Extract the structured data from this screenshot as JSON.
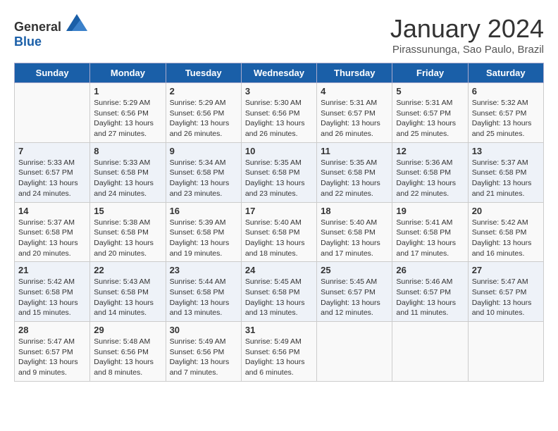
{
  "header": {
    "logo_general": "General",
    "logo_blue": "Blue",
    "month_title": "January 2024",
    "subtitle": "Pirassununga, Sao Paulo, Brazil"
  },
  "days_of_week": [
    "Sunday",
    "Monday",
    "Tuesday",
    "Wednesday",
    "Thursday",
    "Friday",
    "Saturday"
  ],
  "weeks": [
    [
      {
        "day": "",
        "text": ""
      },
      {
        "day": "1",
        "text": "Sunrise: 5:29 AM\nSunset: 6:56 PM\nDaylight: 13 hours\nand 27 minutes."
      },
      {
        "day": "2",
        "text": "Sunrise: 5:29 AM\nSunset: 6:56 PM\nDaylight: 13 hours\nand 26 minutes."
      },
      {
        "day": "3",
        "text": "Sunrise: 5:30 AM\nSunset: 6:56 PM\nDaylight: 13 hours\nand 26 minutes."
      },
      {
        "day": "4",
        "text": "Sunrise: 5:31 AM\nSunset: 6:57 PM\nDaylight: 13 hours\nand 26 minutes."
      },
      {
        "day": "5",
        "text": "Sunrise: 5:31 AM\nSunset: 6:57 PM\nDaylight: 13 hours\nand 25 minutes."
      },
      {
        "day": "6",
        "text": "Sunrise: 5:32 AM\nSunset: 6:57 PM\nDaylight: 13 hours\nand 25 minutes."
      }
    ],
    [
      {
        "day": "7",
        "text": "Sunrise: 5:33 AM\nSunset: 6:57 PM\nDaylight: 13 hours\nand 24 minutes."
      },
      {
        "day": "8",
        "text": "Sunrise: 5:33 AM\nSunset: 6:58 PM\nDaylight: 13 hours\nand 24 minutes."
      },
      {
        "day": "9",
        "text": "Sunrise: 5:34 AM\nSunset: 6:58 PM\nDaylight: 13 hours\nand 23 minutes."
      },
      {
        "day": "10",
        "text": "Sunrise: 5:35 AM\nSunset: 6:58 PM\nDaylight: 13 hours\nand 23 minutes."
      },
      {
        "day": "11",
        "text": "Sunrise: 5:35 AM\nSunset: 6:58 PM\nDaylight: 13 hours\nand 22 minutes."
      },
      {
        "day": "12",
        "text": "Sunrise: 5:36 AM\nSunset: 6:58 PM\nDaylight: 13 hours\nand 22 minutes."
      },
      {
        "day": "13",
        "text": "Sunrise: 5:37 AM\nSunset: 6:58 PM\nDaylight: 13 hours\nand 21 minutes."
      }
    ],
    [
      {
        "day": "14",
        "text": "Sunrise: 5:37 AM\nSunset: 6:58 PM\nDaylight: 13 hours\nand 20 minutes."
      },
      {
        "day": "15",
        "text": "Sunrise: 5:38 AM\nSunset: 6:58 PM\nDaylight: 13 hours\nand 20 minutes."
      },
      {
        "day": "16",
        "text": "Sunrise: 5:39 AM\nSunset: 6:58 PM\nDaylight: 13 hours\nand 19 minutes."
      },
      {
        "day": "17",
        "text": "Sunrise: 5:40 AM\nSunset: 6:58 PM\nDaylight: 13 hours\nand 18 minutes."
      },
      {
        "day": "18",
        "text": "Sunrise: 5:40 AM\nSunset: 6:58 PM\nDaylight: 13 hours\nand 17 minutes."
      },
      {
        "day": "19",
        "text": "Sunrise: 5:41 AM\nSunset: 6:58 PM\nDaylight: 13 hours\nand 17 minutes."
      },
      {
        "day": "20",
        "text": "Sunrise: 5:42 AM\nSunset: 6:58 PM\nDaylight: 13 hours\nand 16 minutes."
      }
    ],
    [
      {
        "day": "21",
        "text": "Sunrise: 5:42 AM\nSunset: 6:58 PM\nDaylight: 13 hours\nand 15 minutes."
      },
      {
        "day": "22",
        "text": "Sunrise: 5:43 AM\nSunset: 6:58 PM\nDaylight: 13 hours\nand 14 minutes."
      },
      {
        "day": "23",
        "text": "Sunrise: 5:44 AM\nSunset: 6:58 PM\nDaylight: 13 hours\nand 13 minutes."
      },
      {
        "day": "24",
        "text": "Sunrise: 5:45 AM\nSunset: 6:58 PM\nDaylight: 13 hours\nand 13 minutes."
      },
      {
        "day": "25",
        "text": "Sunrise: 5:45 AM\nSunset: 6:57 PM\nDaylight: 13 hours\nand 12 minutes."
      },
      {
        "day": "26",
        "text": "Sunrise: 5:46 AM\nSunset: 6:57 PM\nDaylight: 13 hours\nand 11 minutes."
      },
      {
        "day": "27",
        "text": "Sunrise: 5:47 AM\nSunset: 6:57 PM\nDaylight: 13 hours\nand 10 minutes."
      }
    ],
    [
      {
        "day": "28",
        "text": "Sunrise: 5:47 AM\nSunset: 6:57 PM\nDaylight: 13 hours\nand 9 minutes."
      },
      {
        "day": "29",
        "text": "Sunrise: 5:48 AM\nSunset: 6:56 PM\nDaylight: 13 hours\nand 8 minutes."
      },
      {
        "day": "30",
        "text": "Sunrise: 5:49 AM\nSunset: 6:56 PM\nDaylight: 13 hours\nand 7 minutes."
      },
      {
        "day": "31",
        "text": "Sunrise: 5:49 AM\nSunset: 6:56 PM\nDaylight: 13 hours\nand 6 minutes."
      },
      {
        "day": "",
        "text": ""
      },
      {
        "day": "",
        "text": ""
      },
      {
        "day": "",
        "text": ""
      }
    ]
  ]
}
